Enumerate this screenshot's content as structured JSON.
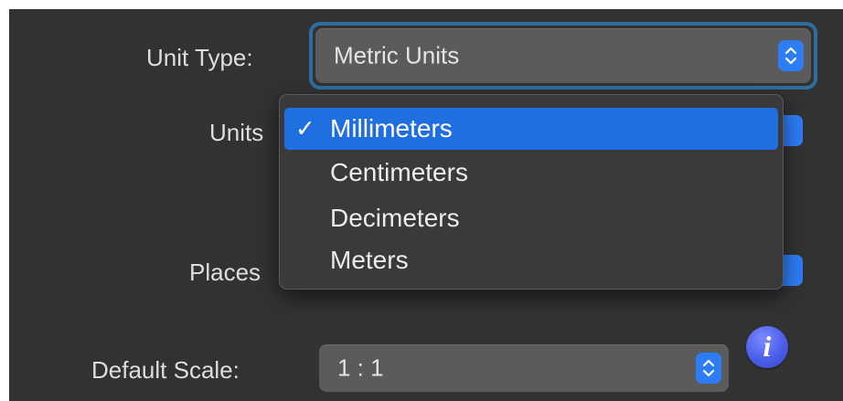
{
  "form": {
    "unit_type": {
      "label": "Unit Type:",
      "value": "Metric Units"
    },
    "units": {
      "label": "Units",
      "options": [
        {
          "label": "Millimeters",
          "selected": true,
          "check": "✓"
        },
        {
          "label": "Centimeters",
          "selected": false,
          "check": ""
        },
        {
          "label": "Decimeters",
          "selected": false,
          "check": ""
        },
        {
          "label": "Meters",
          "selected": false,
          "check": ""
        }
      ]
    },
    "places": {
      "label": "Places"
    },
    "default_scale": {
      "label": "Default Scale:",
      "value": "1 : 1"
    },
    "info_icon": "i"
  },
  "colors": {
    "panel_bg": "#323232",
    "accent": "#2d7df6",
    "selection": "#1f6fe0",
    "focus_ring": "#2e6e9e"
  }
}
